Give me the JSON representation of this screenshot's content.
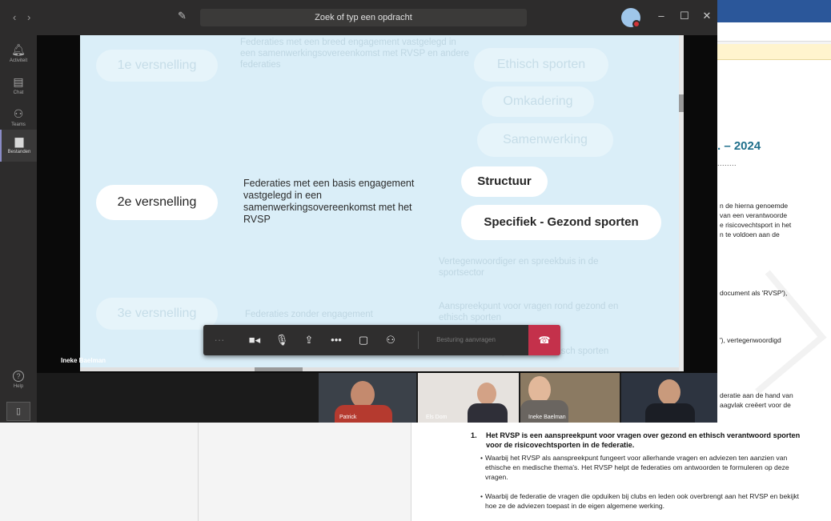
{
  "titlebar": {
    "search_placeholder": "Zoek of typ een opdracht",
    "back_icon": "chevron-left-icon",
    "forward_icon": "chevron-right-icon"
  },
  "rail": {
    "items": [
      {
        "label": "Activiteit",
        "icon": "bell-icon"
      },
      {
        "label": "Chat",
        "icon": "chat-icon"
      },
      {
        "label": "Teams",
        "icon": "teams-icon"
      },
      {
        "label": "Bestanden",
        "icon": "file-icon"
      }
    ],
    "help_label": "Help"
  },
  "slide": {
    "rows": [
      {
        "pill": "1e versnelling",
        "desc": "Federaties met een breed engagement vastgelegd in een samenwerkingsovereenkomst met RVSP en andere federaties"
      },
      {
        "pill": "2e versnelling",
        "desc": "Federaties met een basis engagement vastgelegd in een samenwerkingsovereenkomst met het RVSP"
      },
      {
        "pill": "3e versnelling",
        "desc": "Federaties zonder engagement"
      }
    ],
    "right_top": [
      "Ethisch sporten",
      "Omkadering",
      "Samenwerking"
    ],
    "right_mid": [
      "Structuur",
      "Specifiek - Gezond sporten"
    ],
    "right_bottom": [
      "Vertegenwoordiger en spreekbuis in de sportsector",
      "Aanspreekpunt voor vragen rond gezond en ethisch sporten",
      "Informatiebron gezond en ethisch sporten"
    ]
  },
  "presenter": "Ineke Baelman",
  "toolbar": {
    "control_request": "Besturing aanvragen"
  },
  "participants": [
    "Patrick",
    "Els Dom",
    "Ineke Baelman",
    ""
  ],
  "document": {
    "title": ". – 2024",
    "dots": "........",
    "para1": [
      "n de hierna genoemde",
      "van een verantwoorde",
      "e risicovechtsport in het",
      "n te voldoen aan de"
    ],
    "para2": "document als 'RVSP'),",
    "para3": "'), vertegenwoordigd",
    "para4": [
      "deratie aan de hand van",
      "aagvlak creëert voor de"
    ],
    "numbered_no": "1.",
    "numbered_text": "Het RVSP is een aanspreekpunt voor vragen over gezond en ethisch verantwoord sporten voor de risicovechtsporten in de federatie.",
    "bullets": [
      "Waarbij het RVSP als aanspreekpunt fungeert voor allerhande vragen en adviezen ten aanzien van ethische en medische thema's. Het RVSP helpt de federaties om antwoorden te formuleren op deze vragen.",
      "Waarbij de federatie de vragen die opduiken bij clubs en leden ook overbrengt aan het RVSP en bekijkt hoe ze de adviezen toepast in de eigen algemene werking."
    ]
  },
  "colors": {
    "slide_bg": "#daeef8",
    "teams_titlebar": "#2d2c2c",
    "hangup": "#c4314b",
    "word_ribbon": "#2b579a",
    "doc_title": "#1f6f8b"
  }
}
